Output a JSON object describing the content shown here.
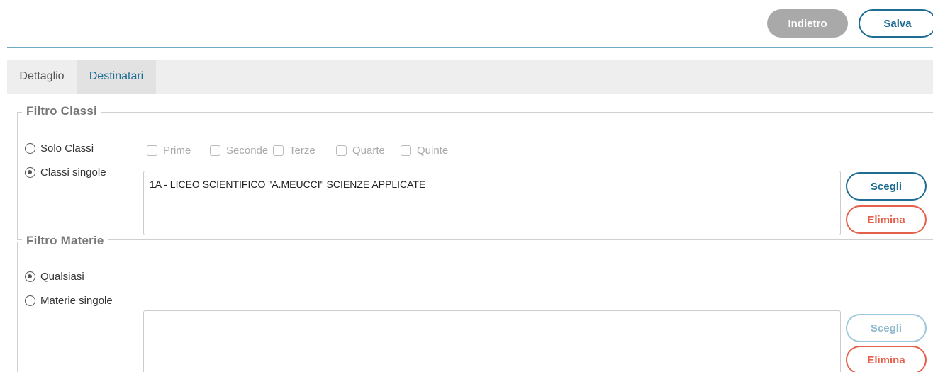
{
  "toolbar": {
    "back_label": "Indietro",
    "save_label": "Salva"
  },
  "tabs": [
    {
      "label": "Dettaglio",
      "active": false
    },
    {
      "label": "Destinatari",
      "active": true
    }
  ],
  "filtro_classi": {
    "legend": "Filtro Classi",
    "options": [
      {
        "label": "Solo Classi",
        "checked": false
      },
      {
        "label": "Classi singole",
        "checked": true
      }
    ],
    "class_checks": [
      "Prime",
      "Seconde",
      "Terze",
      "Quarte",
      "Quinte"
    ],
    "selected_items": [
      "1A - LICEO SCIENTIFICO \"A.MEUCCI\" SCIENZE APPLICATE"
    ],
    "choose_label": "Scegli",
    "delete_label": "Elimina"
  },
  "filtro_materie": {
    "legend": "Filtro Materie",
    "options": [
      {
        "label": "Qualsiasi",
        "checked": true
      },
      {
        "label": "Materie singole",
        "checked": false
      }
    ],
    "selected_items": [],
    "choose_label": "Scegli",
    "delete_label": "Elimina"
  },
  "colors": {
    "primary": "#1f6d93",
    "danger": "#e5604a",
    "disabled_button": "#a9a9a9"
  }
}
